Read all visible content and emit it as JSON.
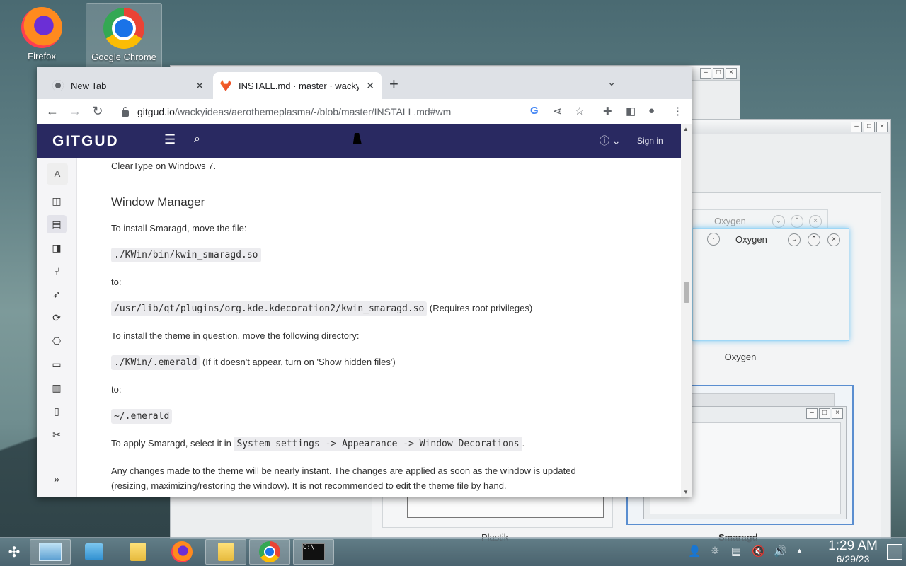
{
  "desktop": {
    "icons": [
      {
        "label": "Firefox"
      },
      {
        "label": "Google Chrome"
      }
    ]
  },
  "background_window": {
    "previews": [
      {
        "title": "Oxygen",
        "label": "Oxygen"
      },
      {
        "title": "Oxygen"
      }
    ],
    "bottom_labels": [
      "Plastik",
      "Smaragd"
    ]
  },
  "browser": {
    "tabs": [
      {
        "title": "New Tab"
      },
      {
        "title": "INSTALL.md · master · wackyideas / aerothemeplasma"
      }
    ],
    "url": {
      "host": "gitgud.io",
      "path": "/wackyideas/aerothemeplasma/-/blob/master/INSTALL.md#wm"
    }
  },
  "gitgud": {
    "logo": "GITGUD",
    "sign_in": "Sign in",
    "sidebar_avatar": "A"
  },
  "doc": {
    "cut_top": "ClearType on Windows 7.",
    "heading": "Window Manager",
    "p1": "To install Smaragd, move the file:",
    "code1": "./KWin/bin/kwin_smaragd.so",
    "to1": "to:",
    "code2": "/usr/lib/qt/plugins/org.kde.kdecoration2/kwin_smaragd.so",
    "note2": "(Requires root privileges)",
    "p2": "To install the theme in question, move the following directory:",
    "code3": "./KWin/.emerald",
    "note3": "(If it doesn't appear, turn on 'Show hidden files')",
    "to2": "to:",
    "code4": "~/.emerald",
    "p3_pre": "To apply Smaragd, select it in",
    "code5": "System settings -> Appearance -> Window Decorations",
    "p3_post": ".",
    "p4_line1": "Any changes made to the theme will be nearly instant. The changes are applied as soon as the window is updated",
    "p4_line2": "(resizing, maximizing/restoring the window). It is not recommended to edit the theme file by hand."
  },
  "taskbar": {
    "time": "1:29 AM",
    "date": "6/29/23",
    "terminal_text": "C:\\_"
  }
}
